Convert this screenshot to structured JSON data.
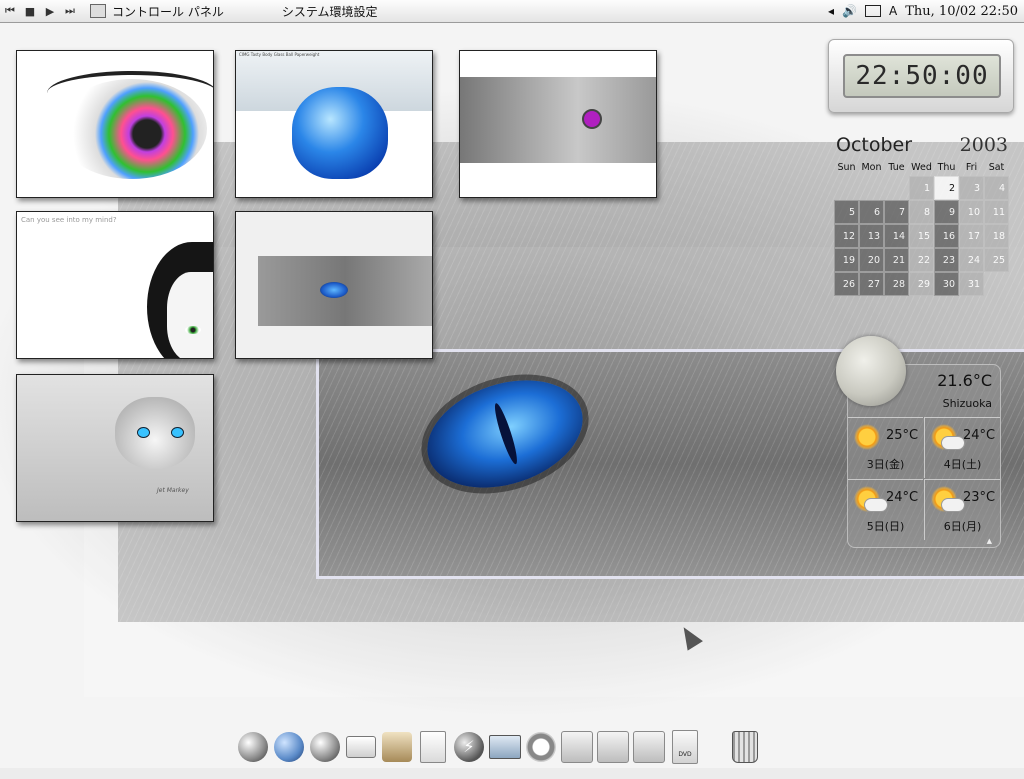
{
  "menubar": {
    "controls": [
      "⏮",
      "■",
      "▶",
      "⏭"
    ],
    "app_name": "コントロール パネル",
    "menu_item": "システム環境設定",
    "tray_arrow": "◂",
    "volume_icon": "🔊",
    "input_mode": "A",
    "clock": "Thu, 10/02 22:50"
  },
  "photos": {
    "p2_caption": "CIMG Tasty Body   Glass Ball Paperweight",
    "p4_caption": "Can you see into my mind?",
    "p6_signature": "Jet Markey"
  },
  "clock_widget": {
    "time": "22:50:00"
  },
  "calendar": {
    "month": "October",
    "year": "2003",
    "weekdays": [
      "Sun",
      "Mon",
      "Tue",
      "Wed",
      "Thu",
      "Fri",
      "Sat"
    ],
    "leading_blanks": 3,
    "days": [
      "1",
      "2",
      "3",
      "4",
      "5",
      "6",
      "7",
      "8",
      "9",
      "10",
      "11",
      "12",
      "13",
      "14",
      "15",
      "16",
      "17",
      "18",
      "19",
      "20",
      "21",
      "22",
      "23",
      "24",
      "25",
      "26",
      "27",
      "28",
      "29",
      "30",
      "31"
    ],
    "today": "2"
  },
  "weather": {
    "current_temp": "21.6°C",
    "city": "Shizuoka",
    "forecast": [
      {
        "temp": "25°C",
        "day": "3日(金)",
        "icon": "sunny-icon"
      },
      {
        "temp": "24°C",
        "day": "4日(土)",
        "icon": "partly-cloudy-icon"
      },
      {
        "temp": "24°C",
        "day": "5日(日)",
        "icon": "partly-cloudy-icon"
      },
      {
        "temp": "23°C",
        "day": "6日(月)",
        "icon": "partly-cloudy-icon"
      }
    ]
  },
  "dock": {
    "items": [
      {
        "name": "globe-icon",
        "glyph": ""
      },
      {
        "name": "network-icon",
        "glyph": ""
      },
      {
        "name": "browser-icon",
        "glyph": ""
      },
      {
        "name": "mail-icon",
        "glyph": ""
      },
      {
        "name": "tools-icon",
        "glyph": ""
      },
      {
        "name": "document-icon",
        "glyph": ""
      },
      {
        "name": "lightning-icon",
        "glyph": "⚡"
      },
      {
        "name": "display-icon",
        "glyph": ""
      },
      {
        "name": "ring-icon",
        "glyph": ""
      },
      {
        "name": "hard-drive-icon",
        "glyph": ""
      },
      {
        "name": "hard-drive-icon",
        "glyph": ""
      },
      {
        "name": "hard-drive-icon",
        "glyph": ""
      },
      {
        "name": "dvd-icon",
        "glyph": "DVD"
      }
    ],
    "trash": {
      "name": "trash-icon"
    }
  }
}
